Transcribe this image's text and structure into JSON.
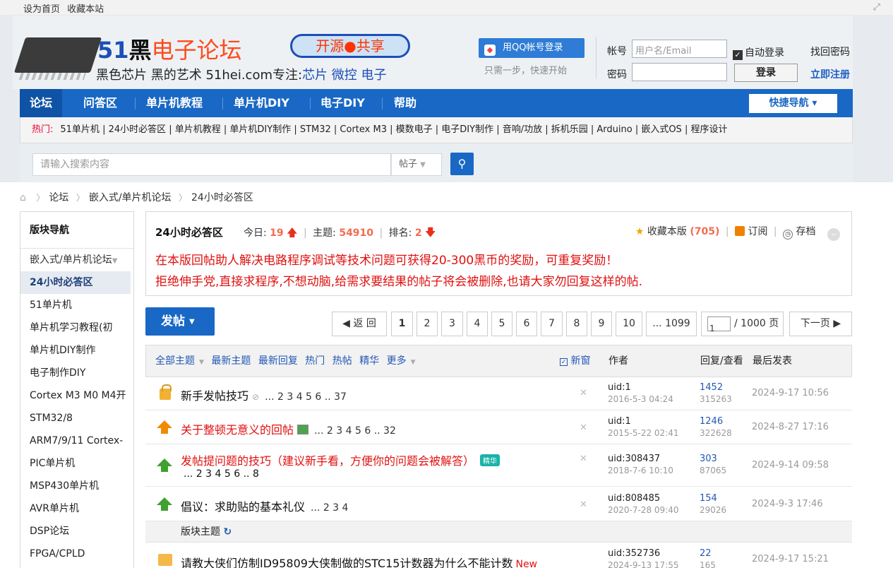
{
  "topbar": {
    "set_home": "设为首页",
    "bookmark": "收藏本站"
  },
  "logo": {
    "brand_num": "51",
    "brand_black": "黑",
    "brand_rest": "电子论坛",
    "sub_black": "黑色芯片 黑的艺术 51hei.com专注:",
    "sub_blue": "芯片 微控 电子",
    "pill": "开源●共享"
  },
  "qq": {
    "button": "用QQ帐号登录",
    "hint": "只需一步，快速开始"
  },
  "login": {
    "account_label": "帐号",
    "account_placeholder": "用户名/Email",
    "auto_login": "自动登录",
    "find_password": "找回密码",
    "password_label": "密码",
    "login_button": "登录",
    "register": "立即注册"
  },
  "nav": {
    "items": [
      "论坛",
      "问答区",
      "单片机教程",
      "单片机DIY",
      "电子DIY",
      "帮助"
    ],
    "quick_nav": "快捷导航"
  },
  "hot": {
    "label": "热门:",
    "links": "51单片机 | 24小时必答区 | 单片机教程 | 单片机DIY制作 | STM32 | Cortex M3 | 模数电子 | 电子DIY制作 | 音响/功放 | 拆机乐园 | Arduino | 嵌入式OS | 程序设计"
  },
  "search": {
    "placeholder": "请输入搜索内容",
    "type": "帖子"
  },
  "breadcrumb": {
    "items": [
      "论坛",
      "嵌入式/单片机论坛",
      "24小时必答区"
    ]
  },
  "sidebar": {
    "heading": "版块导航",
    "group": "嵌入式/单片机论坛",
    "items": [
      "24小时必答区",
      "51单片机",
      "单片机学习教程(初",
      "单片机DIY制作",
      "电子制作DIY",
      "Cortex M3 M0 M4开",
      "STM32/8",
      "ARM7/9/11 Cortex-",
      "PIC单片机",
      "MSP430单片机",
      "AVR单片机",
      "DSP论坛",
      "FPGA/CPLD"
    ]
  },
  "forum": {
    "title": "24小时必答区",
    "today_label": "今日:",
    "today": "19",
    "threads_label": "主题:",
    "threads": "54910",
    "rank_label": "排名:",
    "rank": "2",
    "fav_label": "收藏本版",
    "fav_count": "(705)",
    "subscribe": "订阅",
    "archive": "存档",
    "rule1": "在本版回帖助人解决电路程序调试等技术问题可获得20-300黑币的奖励，可重复奖励！",
    "rule2": "拒绝伸手党,直接求程序,不想动脑,给需求要结果的帖子将会被删除,也请大家勿回复这样的帖."
  },
  "post_button": "发帖",
  "pager": {
    "back": "◀ 返 回",
    "pages": [
      "1",
      "2",
      "3",
      "4",
      "5",
      "6",
      "7",
      "8",
      "9",
      "10",
      "... 1099"
    ],
    "jump_value": "1",
    "total": "/ 1000 页",
    "next": "下一页 ▶"
  },
  "table_head": {
    "filters": [
      "全部主题",
      "最新主题",
      "最新回复",
      "热门",
      "热帖",
      "精华",
      "更多"
    ],
    "new_window": "新窗",
    "author": "作者",
    "reply_view": "回复/查看",
    "last_post": "最后发表"
  },
  "threads": [
    {
      "title": "新手发帖技巧",
      "pages": "... 2  3  4  5  6 .. 37",
      "author": "uid:1",
      "date": "2016-5-3 04:24",
      "replies": "1452",
      "views": "315263",
      "last": "2024-9-17 10:56"
    },
    {
      "title": "关于整顿无意义的回帖",
      "pages": "... 2  3  4  5  6 .. 32",
      "author": "uid:1",
      "date": "2015-5-22 02:41",
      "replies": "1246",
      "views": "322628",
      "last": "2024-8-27 17:16"
    },
    {
      "title": "发帖提问题的技巧（建议新手看，方便你的问题会被解答）",
      "pages": "... 2  3  4  5  6 .. 8",
      "author": "uid:308437",
      "date": "2018-7-6 10:10",
      "replies": "303",
      "views": "87065",
      "last": "2024-9-14 09:58",
      "tag": "精华"
    },
    {
      "title": "倡议：求助贴的基本礼仪",
      "pages": "... 2  3  4",
      "author": "uid:808485",
      "date": "2020-7-28 09:40",
      "replies": "154",
      "views": "29026",
      "last": "2024-9-3 17:46"
    },
    {
      "title": "请教大侠们仿制ID95809大侠制做的STC15计数器为什么不能计数",
      "new": "New",
      "author": "uid:352736",
      "date": "2024-9-13 17:55",
      "replies": "22",
      "views": "165",
      "last": "2024-9-17 15:21"
    }
  ],
  "section_label": "版块主题"
}
